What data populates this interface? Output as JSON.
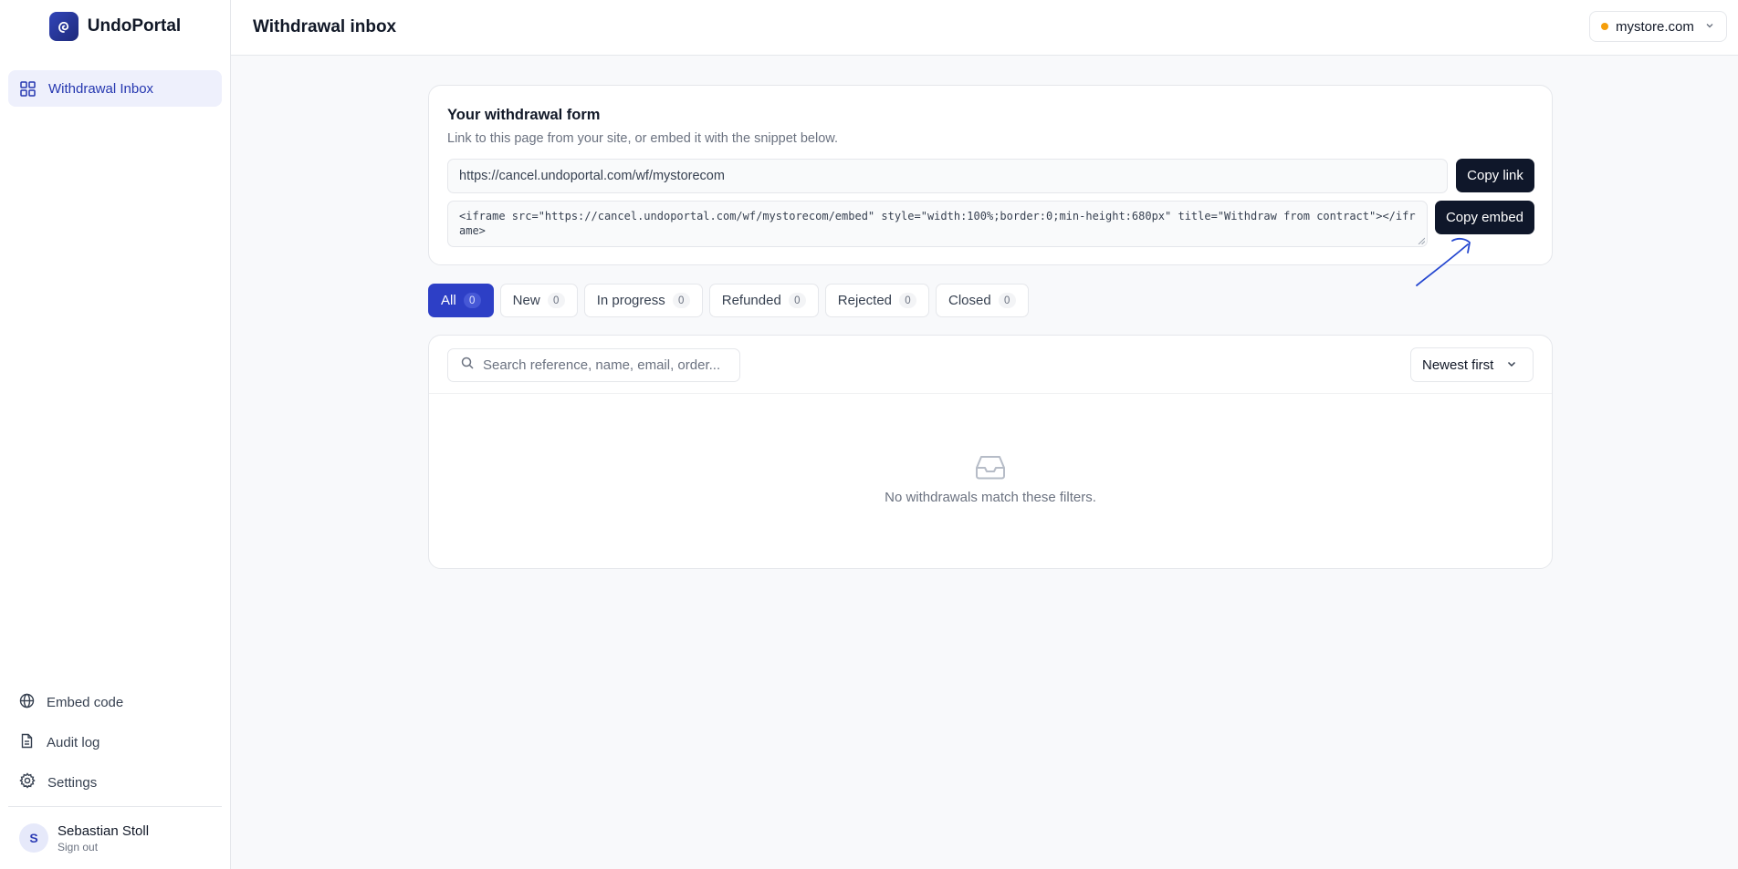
{
  "brand": {
    "name": "UndoPortal",
    "logo_icon": "spiral-logo-icon"
  },
  "sidebar": {
    "nav": [
      {
        "label": "Withdrawal Inbox",
        "icon": "grid-icon",
        "active": true
      }
    ],
    "bottom": [
      {
        "label": "Embed code",
        "icon": "globe-icon"
      },
      {
        "label": "Audit log",
        "icon": "document-icon"
      },
      {
        "label": "Settings",
        "icon": "gear-icon"
      }
    ],
    "user": {
      "initial": "S",
      "name": "Sebastian Stoll",
      "sign_out": "Sign out"
    }
  },
  "header": {
    "title": "Withdrawal inbox",
    "store": {
      "label": "mystore.com",
      "status_color": "#f59e0b"
    }
  },
  "form_card": {
    "title": "Your withdrawal form",
    "subtitle": "Link to this page from your site, or embed it with the snippet below.",
    "link_value": "https://cancel.undoportal.com/wf/mystorecom",
    "copy_link_label": "Copy link",
    "embed_value": "<iframe src=\"https://cancel.undoportal.com/wf/mystorecom/embed\" style=\"width:100%;border:0;min-height:680px\" title=\"Withdraw from contract\"></iframe>",
    "copy_embed_label": "Copy embed"
  },
  "tabs": [
    {
      "label": "All",
      "count": "0",
      "active": true
    },
    {
      "label": "New",
      "count": "0"
    },
    {
      "label": "In progress",
      "count": "0"
    },
    {
      "label": "Refunded",
      "count": "0"
    },
    {
      "label": "Rejected",
      "count": "0"
    },
    {
      "label": "Closed",
      "count": "0"
    }
  ],
  "list": {
    "search_placeholder": "Search reference, name, email, order...",
    "sort_label": "Newest first",
    "empty_text": "No withdrawals match these filters."
  },
  "colors": {
    "accent": "#2d3fc6",
    "dark_button": "#0f172a",
    "annotation_arrow": "#2547d0"
  }
}
